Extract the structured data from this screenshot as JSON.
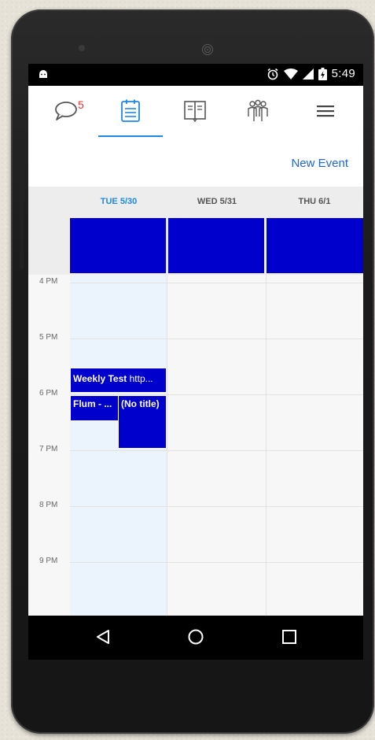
{
  "status_bar": {
    "time": "5:49",
    "icons": [
      "android-icon",
      "alarm-icon",
      "wifi-icon",
      "signal-icon",
      "battery-icon"
    ]
  },
  "top_nav": {
    "items": [
      {
        "name": "messages",
        "icon": "chat-bubble-icon",
        "badge": "5"
      },
      {
        "name": "calendar",
        "icon": "calendar-list-icon",
        "selected": true
      },
      {
        "name": "directory",
        "icon": "book-icon"
      },
      {
        "name": "groups",
        "icon": "people-icon"
      },
      {
        "name": "menu",
        "icon": "hamburger-icon"
      }
    ],
    "accent_color": "#1e88e5"
  },
  "actions": {
    "new_event": "New Event"
  },
  "calendar": {
    "days": [
      "TUE 5/30",
      "WED 5/31",
      "THU 6/1"
    ],
    "today_index": 0,
    "hours": [
      "4 PM",
      "5 PM",
      "6 PM",
      "7 PM",
      "8 PM",
      "9 PM"
    ],
    "event_color": "#0000cc",
    "events": [
      {
        "title": "Weekly Test",
        "detail": "http...",
        "day": "TUE 5/30"
      },
      {
        "title": "Flum - ...",
        "day": "TUE 5/30"
      },
      {
        "title": "(No title)",
        "day": "TUE 5/30"
      }
    ]
  },
  "system_nav": {
    "buttons": [
      "back-icon",
      "home-icon",
      "recents-icon"
    ]
  }
}
